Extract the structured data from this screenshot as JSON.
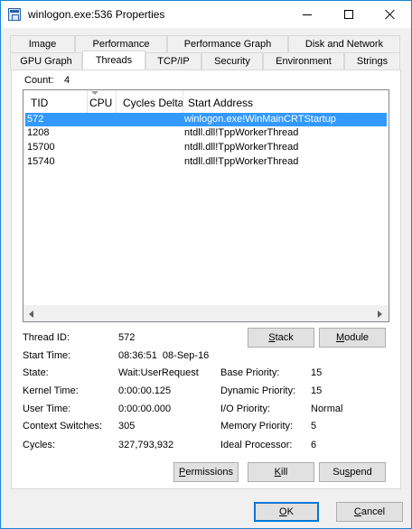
{
  "window": {
    "title": "winlogon.exe:536 Properties"
  },
  "tabs_row1": [
    "Image",
    "Performance",
    "Performance Graph",
    "Disk and Network"
  ],
  "tabs_row2": [
    "GPU Graph",
    "Threads",
    "TCP/IP",
    "Security",
    "Environment",
    "Strings"
  ],
  "active_tab": "Threads",
  "count": {
    "label": "Count:",
    "value": "4"
  },
  "list": {
    "columns": [
      "TID",
      "CPU",
      "Cycles Delta",
      "Start Address"
    ],
    "rows": [
      {
        "tid": "572",
        "cpu": "",
        "cycles": "",
        "address": "winlogon.exe!WinMainCRTStartup",
        "selected": true
      },
      {
        "tid": "1208",
        "cpu": "",
        "cycles": "",
        "address": "ntdll.dll!TppWorkerThread",
        "selected": false
      },
      {
        "tid": "15700",
        "cpu": "",
        "cycles": "",
        "address": "ntdll.dll!TppWorkerThread",
        "selected": false
      },
      {
        "tid": "15740",
        "cpu": "",
        "cycles": "",
        "address": "ntdll.dll!TppWorkerThread",
        "selected": false
      }
    ]
  },
  "details": {
    "thread_id": {
      "label": "Thread ID:",
      "value": "572"
    },
    "start_time": {
      "label": "Start Time:",
      "value": "08:36:51  08-Sep-16"
    },
    "state": {
      "label": "State:",
      "value": "Wait:UserRequest"
    },
    "kernel_time": {
      "label": "Kernel Time:",
      "value": "0:00:00.125"
    },
    "user_time": {
      "label": "User Time:",
      "value": "0:00:00.000"
    },
    "context_switches": {
      "label": "Context Switches:",
      "value": "305"
    },
    "cycles": {
      "label": "Cycles:",
      "value": "327,793,932"
    },
    "base_priority": {
      "label": "Base Priority:",
      "value": "15"
    },
    "dynamic_priority": {
      "label": "Dynamic Priority:",
      "value": "15"
    },
    "io_priority": {
      "label": "I/O Priority:",
      "value": "Normal"
    },
    "memory_priority": {
      "label": "Memory Priority:",
      "value": "5"
    },
    "ideal_processor": {
      "label": "Ideal Processor:",
      "value": "6"
    }
  },
  "buttons": {
    "stack": {
      "mnemonic": "S",
      "rest": "tack"
    },
    "module": {
      "mnemonic": "M",
      "rest": "odule"
    },
    "permissions": {
      "mnemonic": "P",
      "rest": "ermissions"
    },
    "kill": {
      "mnemonic": "K",
      "rest": "ill"
    },
    "suspend": {
      "pre": "Su",
      "mnemonic": "s",
      "rest": "pend"
    },
    "ok": {
      "mnemonic": "O",
      "rest": "K"
    },
    "cancel": {
      "mnemonic": "C",
      "rest": "ancel"
    }
  },
  "colors": {
    "selection": "#3399ff",
    "window_border": "#1883d7",
    "default_button_border": "#0078d7"
  },
  "icons": {
    "app": "process-window-icon",
    "minimize": "minimize-icon",
    "maximize": "maximize-icon",
    "close": "close-icon",
    "sort": "sort-descending-icon",
    "scroll_left": "arrow-left-icon",
    "scroll_right": "arrow-right-icon"
  }
}
